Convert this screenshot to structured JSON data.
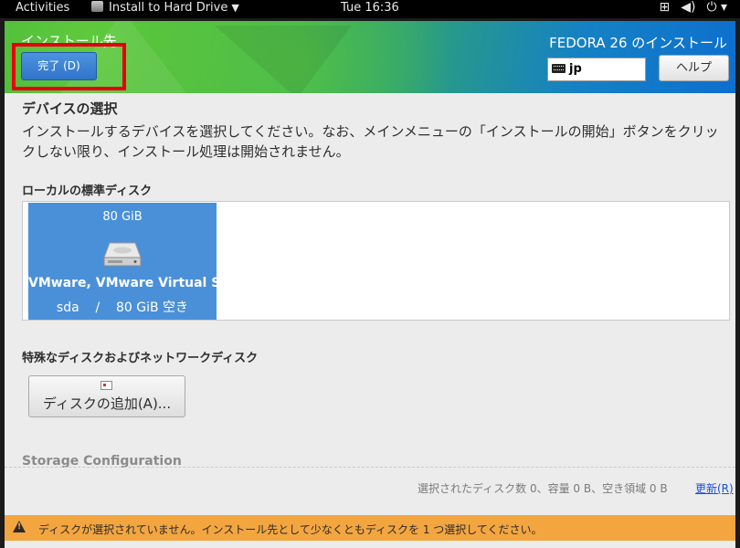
{
  "topbar": {
    "activities": "Activities",
    "app_name": "Install to Hard Drive",
    "clock": "Tue 16:36",
    "icons": [
      "network-icon",
      "volume-icon",
      "power-icon"
    ]
  },
  "header": {
    "spoke_title": "インストール先",
    "done_button": "完了 (D)",
    "product_title": "FEDORA 26 のインストール",
    "keyboard_layout": "jp",
    "help_button": "ヘルプ"
  },
  "device_selection": {
    "title": "デバイスの選択",
    "description": "インストールするデバイスを選択してください。なお、メインメニューの「インストールの開始」ボタンをクリックしない限り、インストール処理は開始されません。"
  },
  "local_disks": {
    "label": "ローカルの標準ディスク",
    "disks": [
      {
        "size": "80 GiB",
        "name": "VMware, VMware Virtual S",
        "detail": "sda    /    80 GiB 空き"
      }
    ]
  },
  "special_disks": {
    "label": "特殊なディスクおよびネットワークディスク",
    "add_button": "ディスクの追加(A)..."
  },
  "storage_config": {
    "label": "Storage Configuration"
  },
  "summary": {
    "text": "選択されたディスク数 0、容量 0 B、空き領域 0 B",
    "refresh_link": "更新(R)"
  },
  "warning": {
    "text": "ディスクが選択されていません。インストール先として少なくともディスクを 1 つ選択してください。"
  },
  "colors": {
    "accent": "#4a90d9",
    "warning": "#f3a640",
    "highlight": "#e6000f"
  }
}
